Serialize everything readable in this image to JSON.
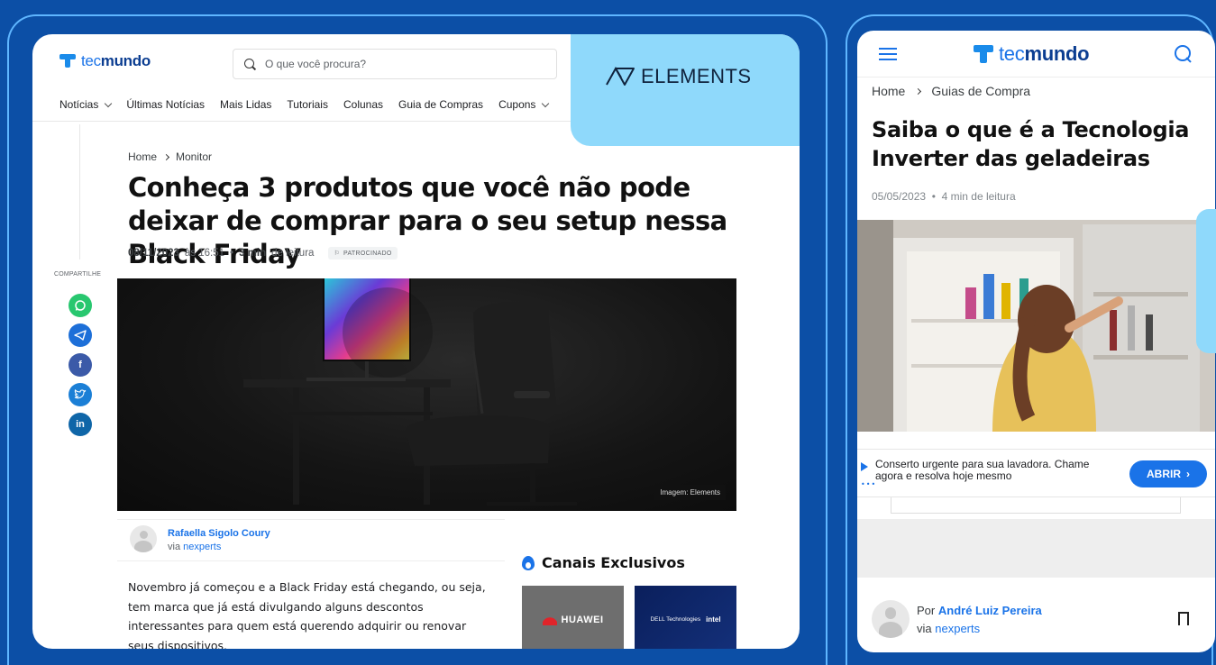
{
  "brand": {
    "accent": "#1a73e8",
    "background": "#0c4fa6",
    "elements_badge_color": "#8fd9fb"
  },
  "elements": {
    "logo_text": "ELEMENTS"
  },
  "desktop": {
    "logo": {
      "light": "tec",
      "bold": "mundo"
    },
    "search": {
      "placeholder": "O que você procura?"
    },
    "nav": [
      {
        "label": "Notícias",
        "has_dropdown": true
      },
      {
        "label": "Últimas Notícias",
        "has_dropdown": false
      },
      {
        "label": "Mais Lidas",
        "has_dropdown": false
      },
      {
        "label": "Tutoriais",
        "has_dropdown": false
      },
      {
        "label": "Colunas",
        "has_dropdown": false
      },
      {
        "label": "Guia de Compras",
        "has_dropdown": false
      },
      {
        "label": "Cupons",
        "has_dropdown": true
      }
    ],
    "breadcrumb": [
      "Home",
      "Monitor"
    ],
    "title": "Conheça 3 produtos que você não pode deixar de comprar para o seu setup nessa Black Friday",
    "meta": {
      "date": "08/11/2023",
      "time_prefix": "às 16:51",
      "dot": "•",
      "read_time": "3 min",
      "read_suffix": "de leitura",
      "badge": "PATROCINADO"
    },
    "share_label": "COMPARTILHE",
    "share_icons": [
      "whatsapp-icon",
      "telegram-icon",
      "facebook-icon",
      "twitter-icon",
      "linkedin-icon"
    ],
    "hero_caption": "Imagem: Elements",
    "author": {
      "name": "Rafaella Sigolo Coury",
      "via_prefix": "via",
      "via": "nexperts"
    },
    "body": "Novembro já começou e a Black Friday está chegando, ou seja, tem marca que já está divulgando alguns descontos interessantes para quem está querendo adquirir ou renovar seus dispositivos.",
    "canais": {
      "title": "Canais Exclusivos",
      "cards": [
        {
          "label": "HUAWEI"
        },
        {
          "label_a": "DELL Technologies",
          "label_b": "intel"
        }
      ]
    }
  },
  "mobile": {
    "logo": {
      "light": "tec",
      "bold": "mundo"
    },
    "breadcrumb": [
      "Home",
      "Guias de Compra"
    ],
    "title": "Saiba o que é a Tecnologia Inverter das geladeiras",
    "meta": "05/05/2023  •  4 min de leitura",
    "ad": {
      "text": "Conserto urgente para sua lavadora. Chame agora e resolva hoje mesmo",
      "button": "ABRIR"
    },
    "author": {
      "prefix": "Por",
      "name": "André Luiz Pereira",
      "via_prefix": "via",
      "via": "nexperts"
    }
  }
}
